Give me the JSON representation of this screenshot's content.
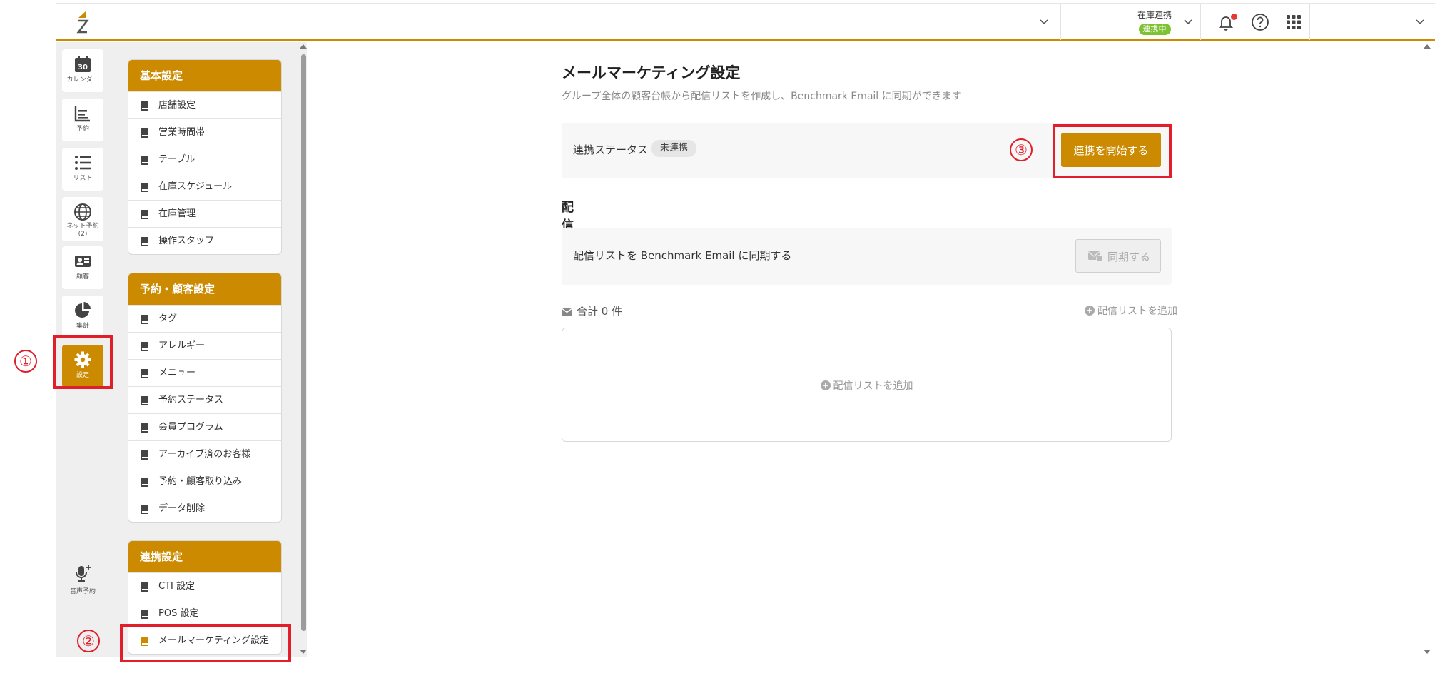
{
  "topbar": {
    "stock_link_label": "在庫連携",
    "stock_link_badge": "連携中"
  },
  "rail": {
    "items": [
      {
        "label": "カレンダー",
        "icon": "calendar-icon",
        "icon_text": "30"
      },
      {
        "label": "予約",
        "icon": "bar-chart-icon"
      },
      {
        "label": "リスト",
        "icon": "list-icon"
      },
      {
        "label": "ネット予約\n(2)",
        "icon": "globe-icon"
      },
      {
        "label": "顧客",
        "icon": "contact-card-icon"
      },
      {
        "label": "集計",
        "icon": "pie-chart-icon"
      },
      {
        "label": "設定",
        "icon": "gear-icon"
      }
    ],
    "voice": {
      "label": "音声予約",
      "icon": "microphone-icon"
    }
  },
  "menu": {
    "groups": [
      {
        "title": "基本設定",
        "items": [
          "店舗設定",
          "営業時間帯",
          "テーブル",
          "在庫スケジュール",
          "在庫管理",
          "操作スタッフ"
        ]
      },
      {
        "title": "予約・顧客設定",
        "items": [
          "タグ",
          "アレルギー",
          "メニュー",
          "予約ステータス",
          "会員プログラム",
          "アーカイブ済のお客様",
          "予約・顧客取り込み",
          "データ削除"
        ]
      },
      {
        "title": "連携設定",
        "items": [
          "CTI 設定",
          "POS 設定",
          "メールマーケティング設定"
        ]
      }
    ]
  },
  "main": {
    "title": "メールマーケティング設定",
    "subtitle": "グループ全体の顧客台帳から配信リストを作成し、Benchmark Email に同期ができます",
    "status_label": "連携ステータス",
    "status_value": "未連携",
    "start_button": "連携を開始する",
    "list_section_title": "配信リスト",
    "sync_label": "配信リストを Benchmark Email に同期する",
    "sync_button": "同期する",
    "total": "合計 0 件",
    "add_list_link": "配信リストを追加",
    "empty_add": "配信リストを追加"
  },
  "annotations": [
    "①",
    "②",
    "③"
  ],
  "colors": {
    "accent": "#cc8a00",
    "highlight": "#e01f2b",
    "badge_green": "#7dc232"
  }
}
